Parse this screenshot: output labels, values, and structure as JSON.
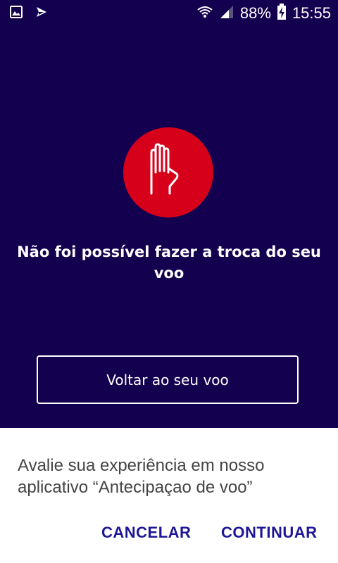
{
  "status_bar": {
    "icons_left": [
      "image-icon",
      "flight-tracker-icon"
    ],
    "icons_right": [
      "wifi-icon",
      "signal-icon",
      "battery-charging-icon"
    ],
    "battery": "88%",
    "time": "15:55"
  },
  "main": {
    "icon": "stop-hand-icon",
    "error_title": "Não foi possível fazer a troca do seu voo",
    "back_button_label": "Voltar ao seu voo"
  },
  "dialog": {
    "message": "Avalie sua experiência em nosso aplicativo “Antecipaçao de voo”",
    "cancel_label": "CANCELAR",
    "continue_label": "CONTINUAR"
  },
  "colors": {
    "background": "#13014f",
    "alert_red": "#d6001a",
    "dialog_button": "#1f1696",
    "dialog_text": "#444444"
  }
}
